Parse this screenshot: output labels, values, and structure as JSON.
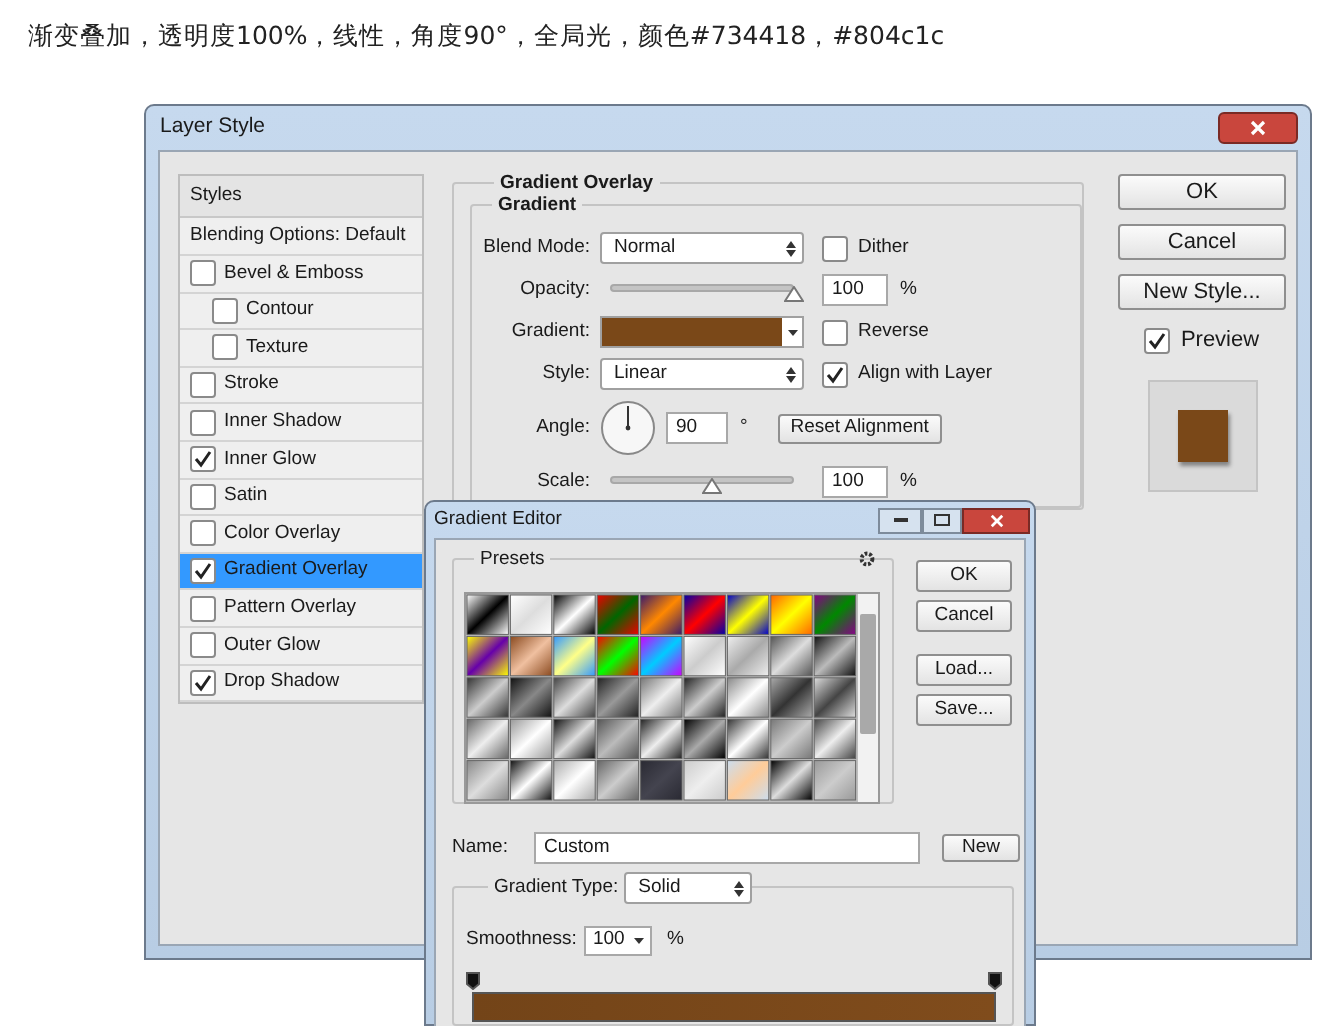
{
  "caption": "渐变叠加，透明度100%，线性，角度90°，全局光，颜色#734418，#804c1c",
  "layer_style": {
    "title": "Layer Style",
    "styles": [
      {
        "label": "Styles",
        "kind": "header",
        "selected": false
      },
      {
        "label": "Blending Options: Default",
        "kind": "plain",
        "selected": false
      },
      {
        "label": "Bevel & Emboss",
        "kind": "check",
        "checked": false,
        "selected": false,
        "children": [
          {
            "label": "Contour",
            "kind": "check",
            "checked": false,
            "selected": false
          },
          {
            "label": "Texture",
            "kind": "check",
            "checked": false,
            "selected": false
          }
        ]
      },
      {
        "label": "Stroke",
        "kind": "check",
        "checked": false,
        "selected": false
      },
      {
        "label": "Inner Shadow",
        "kind": "check",
        "checked": false,
        "selected": false
      },
      {
        "label": "Inner Glow",
        "kind": "check",
        "checked": true,
        "selected": false
      },
      {
        "label": "Satin",
        "kind": "check",
        "checked": false,
        "selected": false
      },
      {
        "label": "Color Overlay",
        "kind": "check",
        "checked": false,
        "selected": false
      },
      {
        "label": "Gradient Overlay",
        "kind": "check",
        "checked": true,
        "selected": true
      },
      {
        "label": "Pattern Overlay",
        "kind": "check",
        "checked": false,
        "selected": false
      },
      {
        "label": "Outer Glow",
        "kind": "check",
        "checked": false,
        "selected": false
      },
      {
        "label": "Drop Shadow",
        "kind": "check",
        "checked": true,
        "selected": false
      }
    ],
    "section_title": "Gradient Overlay",
    "group_title": "Gradient",
    "blend_mode": {
      "label": "Blend Mode:",
      "value": "Normal"
    },
    "dither": {
      "label": "Dither",
      "checked": false
    },
    "opacity": {
      "label": "Opacity:",
      "level": 1,
      "value": "100",
      "unit": "%"
    },
    "gradient": {
      "label": "Gradient:"
    },
    "reverse": {
      "label": "Reverse",
      "checked": false
    },
    "style": {
      "label": "Style:",
      "value": "Linear"
    },
    "align": {
      "label": "Align with Layer",
      "checked": true
    },
    "angle": {
      "label": "Angle:",
      "value": "90",
      "unit": "°"
    },
    "reset_button": "Reset Alignment",
    "scale": {
      "label": "Scale:",
      "level": 0.55,
      "value": "100",
      "unit": "%"
    },
    "buttons": [
      "OK",
      "Cancel",
      "New Style..."
    ],
    "preview": {
      "label": "Preview",
      "checked": true
    }
  },
  "gradient_editor": {
    "title": "Gradient Editor",
    "presets_label": "Presets",
    "buttons": [
      "OK",
      "Cancel",
      "Load...",
      "Save..."
    ],
    "name": {
      "label": "Name:",
      "value": "Custom"
    },
    "new_button": "New",
    "gradient_type": {
      "label": "Gradient Type:",
      "value": "Solid"
    },
    "smoothness": {
      "label": "Smoothness:",
      "value": "100",
      "unit": "%"
    }
  }
}
